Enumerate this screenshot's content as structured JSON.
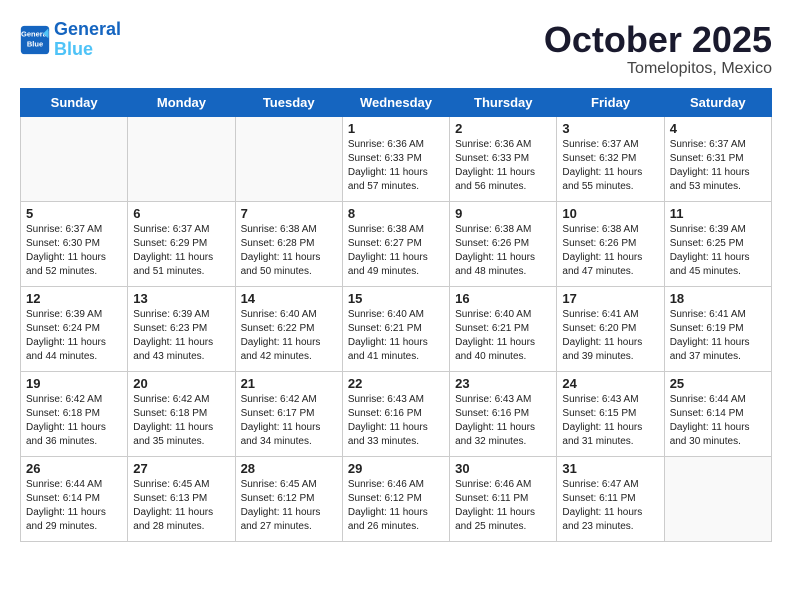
{
  "header": {
    "logo_line1": "General",
    "logo_line2": "Blue",
    "month": "October 2025",
    "location": "Tomelopitos, Mexico"
  },
  "weekdays": [
    "Sunday",
    "Monday",
    "Tuesday",
    "Wednesday",
    "Thursday",
    "Friday",
    "Saturday"
  ],
  "weeks": [
    [
      {
        "day": "",
        "sunrise": "",
        "sunset": "",
        "daylight": ""
      },
      {
        "day": "",
        "sunrise": "",
        "sunset": "",
        "daylight": ""
      },
      {
        "day": "",
        "sunrise": "",
        "sunset": "",
        "daylight": ""
      },
      {
        "day": "1",
        "sunrise": "Sunrise: 6:36 AM",
        "sunset": "Sunset: 6:33 PM",
        "daylight": "Daylight: 11 hours and 57 minutes."
      },
      {
        "day": "2",
        "sunrise": "Sunrise: 6:36 AM",
        "sunset": "Sunset: 6:33 PM",
        "daylight": "Daylight: 11 hours and 56 minutes."
      },
      {
        "day": "3",
        "sunrise": "Sunrise: 6:37 AM",
        "sunset": "Sunset: 6:32 PM",
        "daylight": "Daylight: 11 hours and 55 minutes."
      },
      {
        "day": "4",
        "sunrise": "Sunrise: 6:37 AM",
        "sunset": "Sunset: 6:31 PM",
        "daylight": "Daylight: 11 hours and 53 minutes."
      }
    ],
    [
      {
        "day": "5",
        "sunrise": "Sunrise: 6:37 AM",
        "sunset": "Sunset: 6:30 PM",
        "daylight": "Daylight: 11 hours and 52 minutes."
      },
      {
        "day": "6",
        "sunrise": "Sunrise: 6:37 AM",
        "sunset": "Sunset: 6:29 PM",
        "daylight": "Daylight: 11 hours and 51 minutes."
      },
      {
        "day": "7",
        "sunrise": "Sunrise: 6:38 AM",
        "sunset": "Sunset: 6:28 PM",
        "daylight": "Daylight: 11 hours and 50 minutes."
      },
      {
        "day": "8",
        "sunrise": "Sunrise: 6:38 AM",
        "sunset": "Sunset: 6:27 PM",
        "daylight": "Daylight: 11 hours and 49 minutes."
      },
      {
        "day": "9",
        "sunrise": "Sunrise: 6:38 AM",
        "sunset": "Sunset: 6:26 PM",
        "daylight": "Daylight: 11 hours and 48 minutes."
      },
      {
        "day": "10",
        "sunrise": "Sunrise: 6:38 AM",
        "sunset": "Sunset: 6:26 PM",
        "daylight": "Daylight: 11 hours and 47 minutes."
      },
      {
        "day": "11",
        "sunrise": "Sunrise: 6:39 AM",
        "sunset": "Sunset: 6:25 PM",
        "daylight": "Daylight: 11 hours and 45 minutes."
      }
    ],
    [
      {
        "day": "12",
        "sunrise": "Sunrise: 6:39 AM",
        "sunset": "Sunset: 6:24 PM",
        "daylight": "Daylight: 11 hours and 44 minutes."
      },
      {
        "day": "13",
        "sunrise": "Sunrise: 6:39 AM",
        "sunset": "Sunset: 6:23 PM",
        "daylight": "Daylight: 11 hours and 43 minutes."
      },
      {
        "day": "14",
        "sunrise": "Sunrise: 6:40 AM",
        "sunset": "Sunset: 6:22 PM",
        "daylight": "Daylight: 11 hours and 42 minutes."
      },
      {
        "day": "15",
        "sunrise": "Sunrise: 6:40 AM",
        "sunset": "Sunset: 6:21 PM",
        "daylight": "Daylight: 11 hours and 41 minutes."
      },
      {
        "day": "16",
        "sunrise": "Sunrise: 6:40 AM",
        "sunset": "Sunset: 6:21 PM",
        "daylight": "Daylight: 11 hours and 40 minutes."
      },
      {
        "day": "17",
        "sunrise": "Sunrise: 6:41 AM",
        "sunset": "Sunset: 6:20 PM",
        "daylight": "Daylight: 11 hours and 39 minutes."
      },
      {
        "day": "18",
        "sunrise": "Sunrise: 6:41 AM",
        "sunset": "Sunset: 6:19 PM",
        "daylight": "Daylight: 11 hours and 37 minutes."
      }
    ],
    [
      {
        "day": "19",
        "sunrise": "Sunrise: 6:42 AM",
        "sunset": "Sunset: 6:18 PM",
        "daylight": "Daylight: 11 hours and 36 minutes."
      },
      {
        "day": "20",
        "sunrise": "Sunrise: 6:42 AM",
        "sunset": "Sunset: 6:18 PM",
        "daylight": "Daylight: 11 hours and 35 minutes."
      },
      {
        "day": "21",
        "sunrise": "Sunrise: 6:42 AM",
        "sunset": "Sunset: 6:17 PM",
        "daylight": "Daylight: 11 hours and 34 minutes."
      },
      {
        "day": "22",
        "sunrise": "Sunrise: 6:43 AM",
        "sunset": "Sunset: 6:16 PM",
        "daylight": "Daylight: 11 hours and 33 minutes."
      },
      {
        "day": "23",
        "sunrise": "Sunrise: 6:43 AM",
        "sunset": "Sunset: 6:16 PM",
        "daylight": "Daylight: 11 hours and 32 minutes."
      },
      {
        "day": "24",
        "sunrise": "Sunrise: 6:43 AM",
        "sunset": "Sunset: 6:15 PM",
        "daylight": "Daylight: 11 hours and 31 minutes."
      },
      {
        "day": "25",
        "sunrise": "Sunrise: 6:44 AM",
        "sunset": "Sunset: 6:14 PM",
        "daylight": "Daylight: 11 hours and 30 minutes."
      }
    ],
    [
      {
        "day": "26",
        "sunrise": "Sunrise: 6:44 AM",
        "sunset": "Sunset: 6:14 PM",
        "daylight": "Daylight: 11 hours and 29 minutes."
      },
      {
        "day": "27",
        "sunrise": "Sunrise: 6:45 AM",
        "sunset": "Sunset: 6:13 PM",
        "daylight": "Daylight: 11 hours and 28 minutes."
      },
      {
        "day": "28",
        "sunrise": "Sunrise: 6:45 AM",
        "sunset": "Sunset: 6:12 PM",
        "daylight": "Daylight: 11 hours and 27 minutes."
      },
      {
        "day": "29",
        "sunrise": "Sunrise: 6:46 AM",
        "sunset": "Sunset: 6:12 PM",
        "daylight": "Daylight: 11 hours and 26 minutes."
      },
      {
        "day": "30",
        "sunrise": "Sunrise: 6:46 AM",
        "sunset": "Sunset: 6:11 PM",
        "daylight": "Daylight: 11 hours and 25 minutes."
      },
      {
        "day": "31",
        "sunrise": "Sunrise: 6:47 AM",
        "sunset": "Sunset: 6:11 PM",
        "daylight": "Daylight: 11 hours and 23 minutes."
      },
      {
        "day": "",
        "sunrise": "",
        "sunset": "",
        "daylight": ""
      }
    ]
  ]
}
